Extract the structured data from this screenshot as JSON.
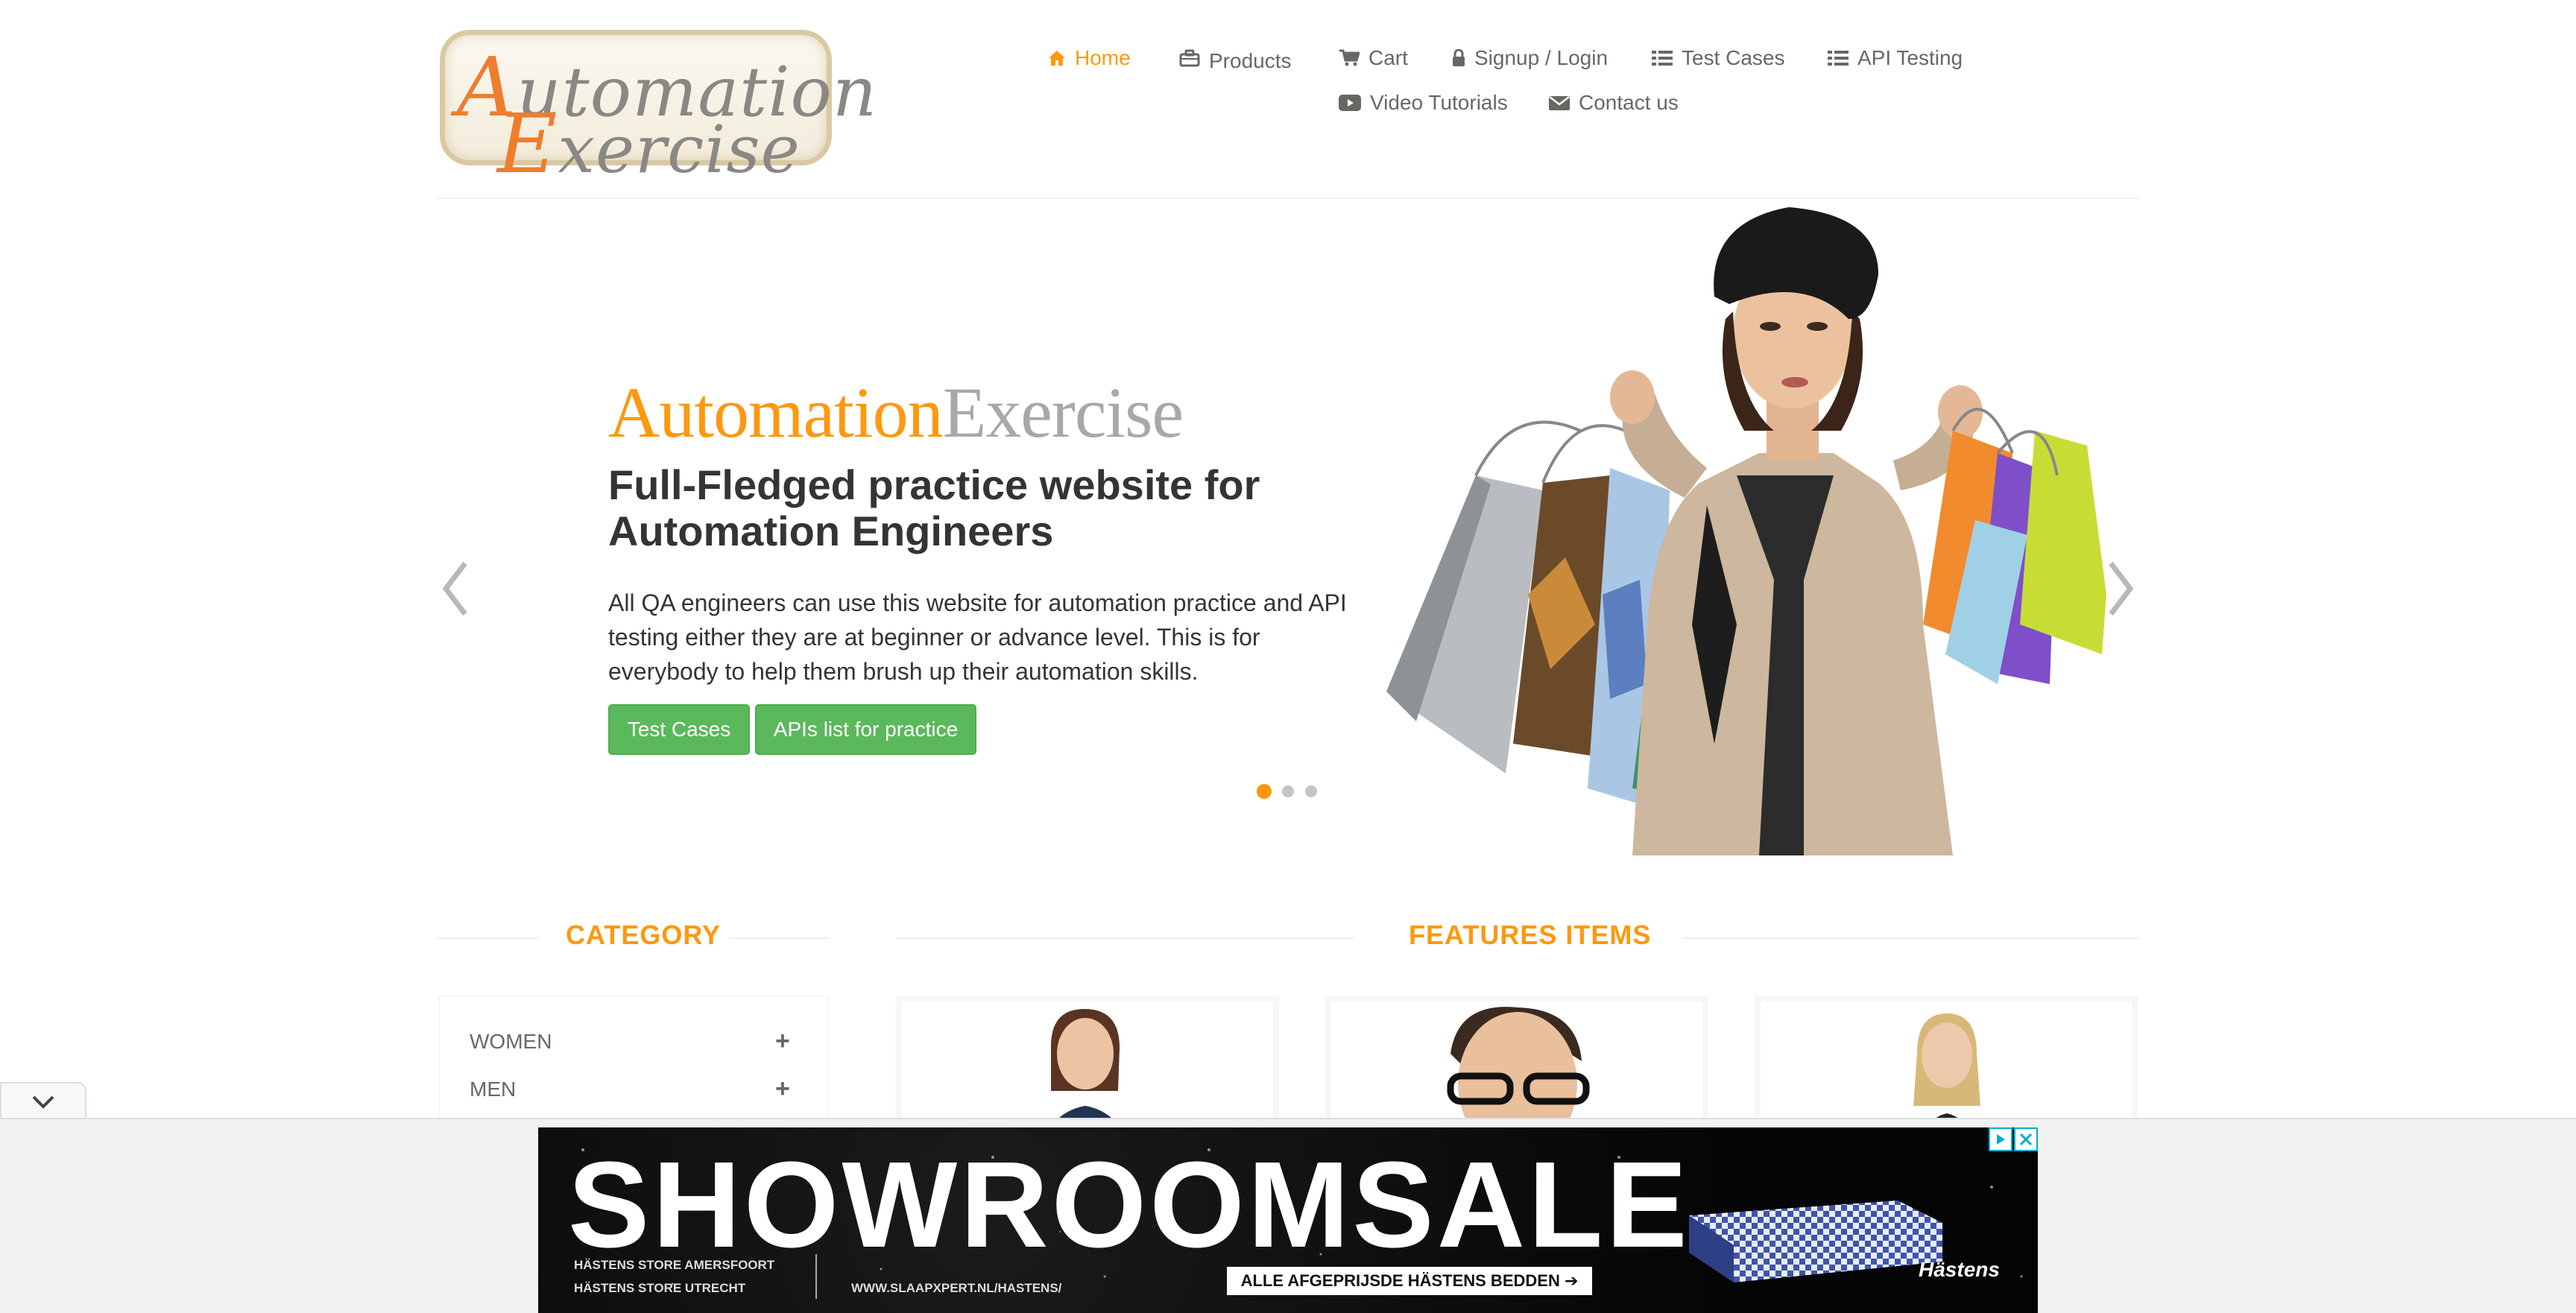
{
  "header": {
    "logo": {
      "line1_cap": "A",
      "line1_rest": "utomation",
      "line2_cap": "E",
      "line2_rest": "xercise"
    },
    "nav": [
      {
        "label": "Home",
        "icon": "home-icon",
        "active": true
      },
      {
        "label": "Products",
        "icon": "briefcase-icon"
      },
      {
        "label": "Cart",
        "icon": "cart-icon"
      },
      {
        "label": "Signup / Login",
        "icon": "lock-icon"
      },
      {
        "label": "Test Cases",
        "icon": "list-icon"
      },
      {
        "label": "API Testing",
        "icon": "list-icon"
      },
      {
        "label": "Video Tutorials",
        "icon": "youtube-play-icon"
      },
      {
        "label": "Contact us",
        "icon": "envelope-icon"
      }
    ]
  },
  "hero": {
    "brand_a": "Automation",
    "brand_b": "Exercise",
    "title_line1": "Full-Fledged practice website for",
    "title_line2": "Automation Engineers",
    "desc_line1": "All QA engineers can use this website for automation practice and API",
    "desc_line2": "testing either they are at beginner or advance level. This is for",
    "desc_line3": "everybody to help them brush up their automation skills.",
    "btn_test_cases": "Test Cases",
    "btn_apis": "APIs list for practice",
    "slides_total": 3,
    "slide_active": 1
  },
  "category": {
    "title": "CATEGORY",
    "items": [
      "WOMEN",
      "MEN"
    ]
  },
  "features": {
    "title": "FEATURES ITEMS"
  },
  "ad": {
    "headline_a": "SHOWROOM",
    "headline_b": "SALE",
    "store1": "HÄSTENS STORE AMERSFOORT",
    "store2": "HÄSTENS STORE UTRECHT",
    "url": "WWW.SLAAPXPERT.NL/HASTENS/",
    "cta": "ALLE AFGEPRIJSDE HÄSTENS BEDDEN ➔",
    "brand": "Hästens"
  },
  "colors": {
    "accent": "#fe980f",
    "button": "#5cb85c",
    "text": "#696763",
    "heading": "#363432"
  }
}
